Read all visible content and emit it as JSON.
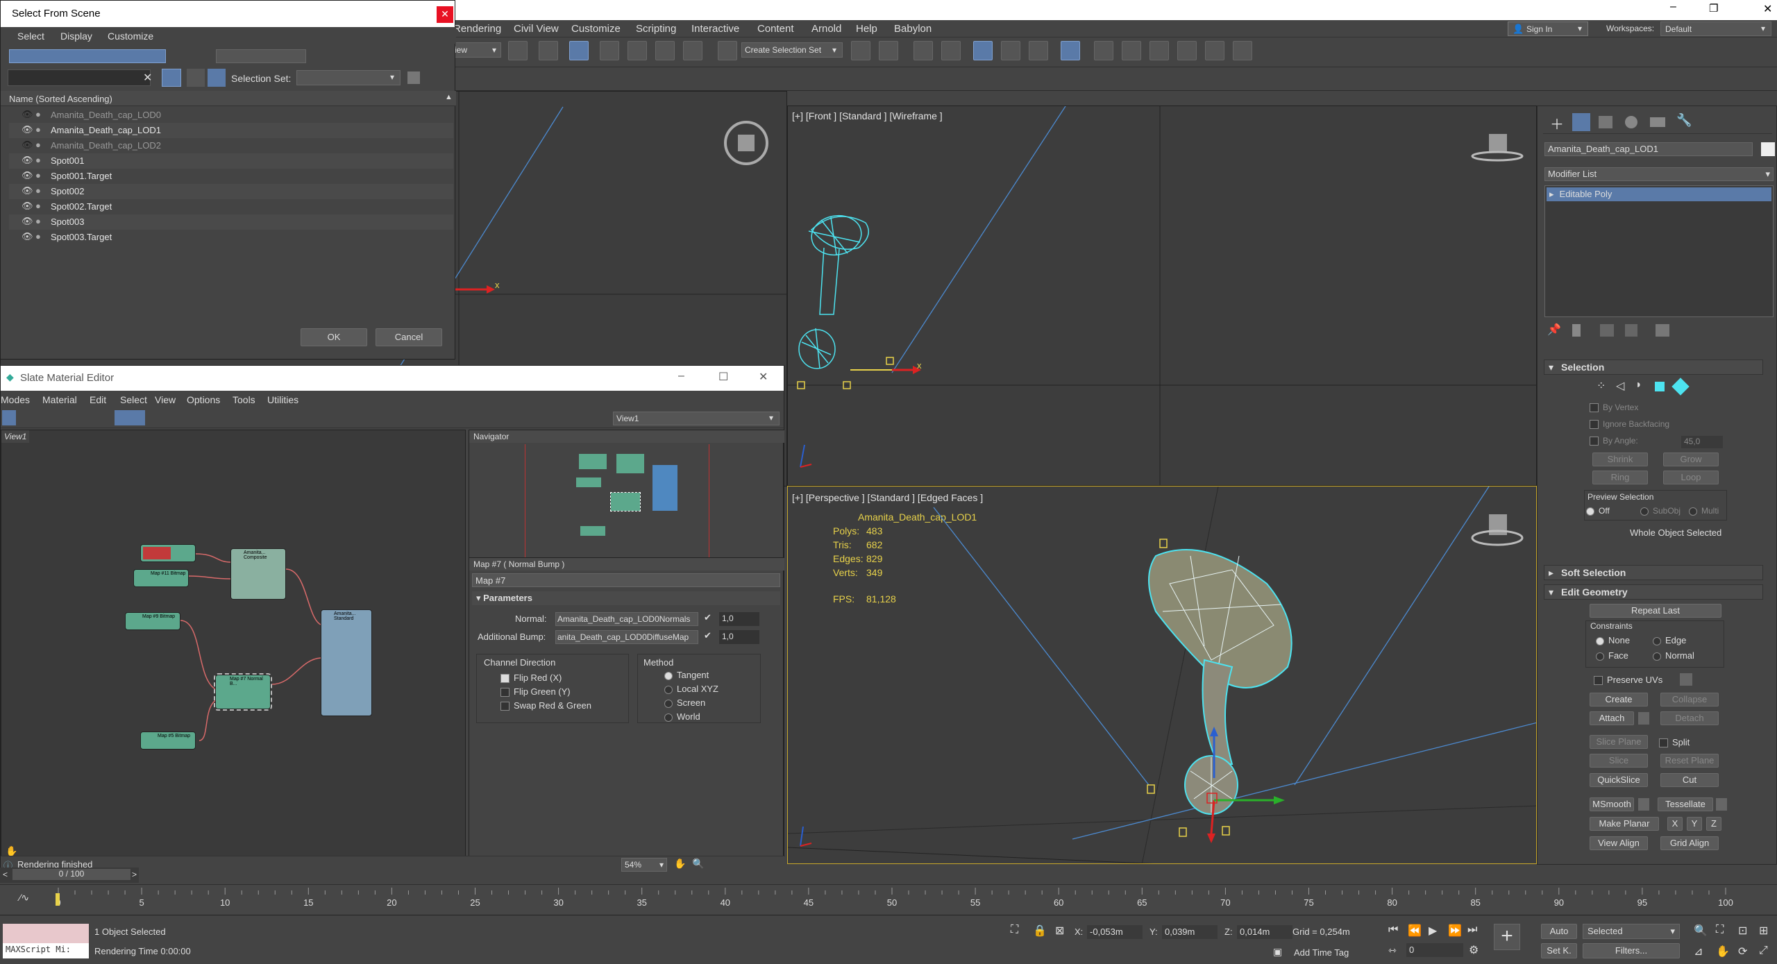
{
  "title_bar": {
    "sign_in": "Sign In",
    "workspaces_label": "Workspaces:",
    "workspace": "Default"
  },
  "menu": [
    "Rendering",
    "Civil View",
    "Customize",
    "Scripting",
    "Interactive",
    "Content",
    "Arnold",
    "Help",
    "Babylon"
  ],
  "toolbar": {
    "view_dropdown": "iew",
    "selection_set": "Create Selection Set"
  },
  "select_from_scene": {
    "title": "Select From Scene",
    "menu": [
      "Select",
      "Display",
      "Customize"
    ],
    "selection_set_label": "Selection Set:",
    "column_header": "Name (Sorted Ascending)",
    "items": [
      {
        "name": "Amanita_Death_cap_LOD0",
        "hidden": true
      },
      {
        "name": "Amanita_Death_cap_LOD1",
        "hidden": false
      },
      {
        "name": "Amanita_Death_cap_LOD2",
        "hidden": true
      },
      {
        "name": "Spot001",
        "hidden": false
      },
      {
        "name": "Spot001.Target",
        "hidden": false
      },
      {
        "name": "Spot002",
        "hidden": false
      },
      {
        "name": "Spot002.Target",
        "hidden": false
      },
      {
        "name": "Spot003",
        "hidden": false
      },
      {
        "name": "Spot003.Target",
        "hidden": false
      }
    ],
    "ok": "OK",
    "cancel": "Cancel"
  },
  "viewports": {
    "front_label": "[+] [Front ] [Standard ] [Wireframe ]",
    "persp_label": "[+] [Perspective ] [Standard ] [Edged Faces ]",
    "axis_x": "x",
    "stats": {
      "object": "Amanita_Death_cap_LOD1",
      "polys_label": "Polys:",
      "polys": "483",
      "tris_label": "Tris:",
      "tris": "682",
      "edges_label": "Edges:",
      "edges": "829",
      "verts_label": "Verts:",
      "verts": "349",
      "fps_label": "FPS:",
      "fps": "81,128"
    }
  },
  "slate": {
    "title": "Slate Material Editor",
    "menu": [
      "Modes",
      "Material",
      "Edit",
      "Select",
      "View",
      "Options",
      "Tools",
      "Utilities"
    ],
    "view_dropdown": "View1",
    "tab": "View1",
    "navigator": "Navigator",
    "map_header": "Map #7  ( Normal Bump )",
    "map_name": "Map #7",
    "parameters": "Parameters",
    "normal_label": "Normal:",
    "normal_value": "Amanita_Death_cap_LOD0Normals",
    "normal_amount": "1,0",
    "bump_label": "Additional Bump:",
    "bump_value": "anita_Death_cap_LOD0DiffuseMap",
    "bump_amount": "1,0",
    "channel_direction": "Channel Direction",
    "flip_red": "Flip Red (X)",
    "flip_green": "Flip Green (Y)",
    "swap": "Swap Red & Green",
    "method": "Method",
    "tangent": "Tangent",
    "local_xyz": "Local XYZ",
    "screen": "Screen",
    "world": "World",
    "zoom": "54%",
    "status": "Rendering finished",
    "nodes": [
      "Map #11 Bitmap",
      "Amanita... Composite",
      "Amanita... Standard",
      "Map #9 Bitmap",
      "Map #7 Normal B...",
      "Map #5 Bitmap"
    ]
  },
  "command_panel": {
    "object_name": "Amanita_Death_cap_LOD1",
    "modifier_list": "Modifier List",
    "stack_item": "Editable Poly",
    "selection": "Selection",
    "by_vertex": "By Vertex",
    "ignore_backfacing": "Ignore Backfacing",
    "by_angle": "By Angle:",
    "angle_value": "45,0",
    "shrink": "Shrink",
    "grow": "Grow",
    "ring": "Ring",
    "loop": "Loop",
    "preview_selection": "Preview Selection",
    "off": "Off",
    "subobj": "SubObj",
    "multi": "Multi",
    "whole_object": "Whole Object Selected",
    "soft_selection": "Soft Selection",
    "edit_geometry": "Edit Geometry",
    "repeat_last": "Repeat Last",
    "constraints": "Constraints",
    "none": "None",
    "edge": "Edge",
    "face": "Face",
    "normal": "Normal",
    "preserve_uvs": "Preserve UVs",
    "create": "Create",
    "collapse": "Collapse",
    "attach": "Attach",
    "detach": "Detach",
    "slice_plane": "Slice Plane",
    "split": "Split",
    "slice": "Slice",
    "reset_plane": "Reset Plane",
    "quickslice": "QuickSlice",
    "cut": "Cut",
    "msmooth": "MSmooth",
    "tessellate": "Tessellate",
    "make_planar": "Make Planar",
    "x": "X",
    "y": "Y",
    "z": "Z",
    "view_align": "View Align",
    "grid_align": "Grid Align"
  },
  "timeline": {
    "frame_counter": "0 / 100",
    "ticks": [
      "0",
      "5",
      "10",
      "15",
      "20",
      "25",
      "30",
      "35",
      "40",
      "45",
      "50",
      "55",
      "60",
      "65",
      "70",
      "75",
      "80",
      "85",
      "90",
      "95",
      "100"
    ]
  },
  "status": {
    "maxscript": "MAXScript Mi:",
    "selected": "1 Object Selected",
    "render_time": "Rendering Time  0:00:00",
    "x_label": "X:",
    "x": "-0,053m",
    "y_label": "Y:",
    "y": "0,039m",
    "z_label": "Z:",
    "z": "0,014m",
    "grid": "Grid = 0,254m",
    "add_time_tag": "Add Time Tag",
    "auto": "Auto",
    "selected_dd": "Selected",
    "set_k": "Set K.",
    "filters": "Filters...",
    "frame": "0"
  }
}
